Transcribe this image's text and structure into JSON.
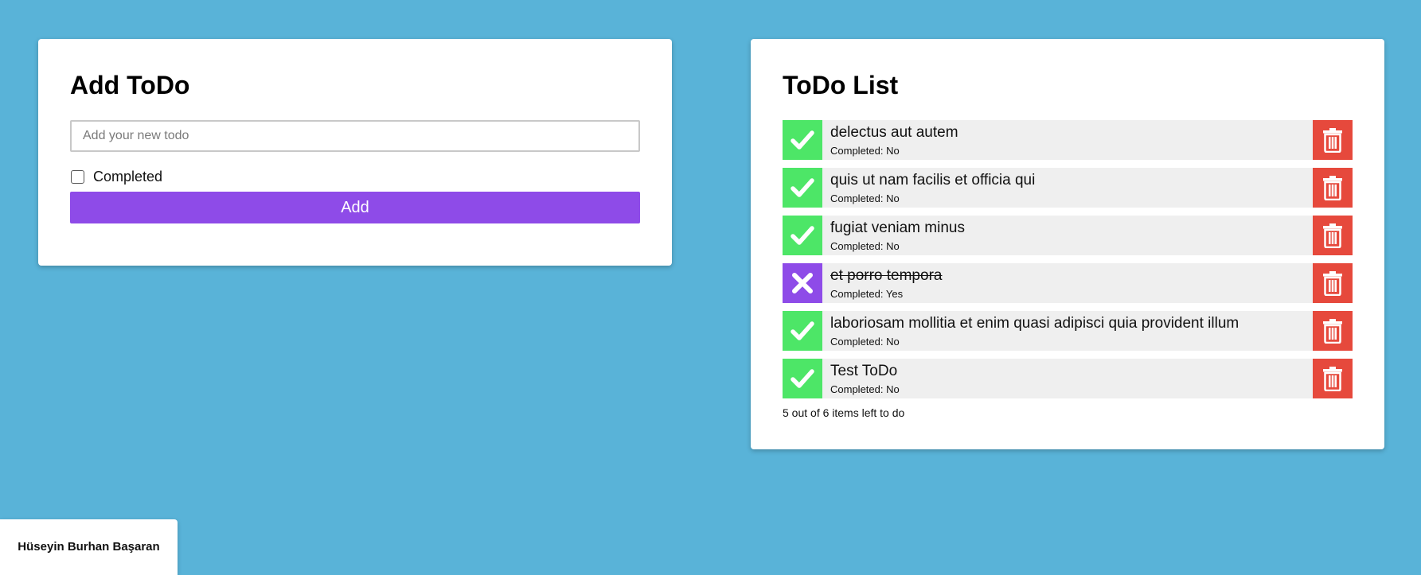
{
  "add_card": {
    "title": "Add ToDo",
    "input": {
      "placeholder": "Add your new todo",
      "value": ""
    },
    "completed_label": "Completed",
    "completed_checked": false,
    "add_button_label": "Add"
  },
  "list_card": {
    "title": "ToDo List",
    "items": [
      {
        "title": "delectus aut autem",
        "status": "Completed: No",
        "completed": false
      },
      {
        "title": "quis ut nam facilis et officia qui",
        "status": "Completed: No",
        "completed": false
      },
      {
        "title": "fugiat veniam minus",
        "status": "Completed: No",
        "completed": false
      },
      {
        "title": "et porro tempora",
        "status": "Completed: Yes",
        "completed": true
      },
      {
        "title": "laboriosam mollitia et enim quasi adipisci quia provident illum",
        "status": "Completed: No",
        "completed": false
      },
      {
        "title": "Test ToDo",
        "status": "Completed: No",
        "completed": false
      }
    ],
    "summary": "5 out of 6 items left to do"
  },
  "footer": {
    "author": "Hüseyin Burhan Başaran"
  },
  "colors": {
    "background": "#59b3d8",
    "accent_purple": "#8e4be8",
    "done_green": "#4de667",
    "delete_red": "#e6493c"
  },
  "icons": {
    "toggle_incomplete": "check-icon",
    "toggle_completed": "close-icon",
    "delete": "trash-icon"
  }
}
